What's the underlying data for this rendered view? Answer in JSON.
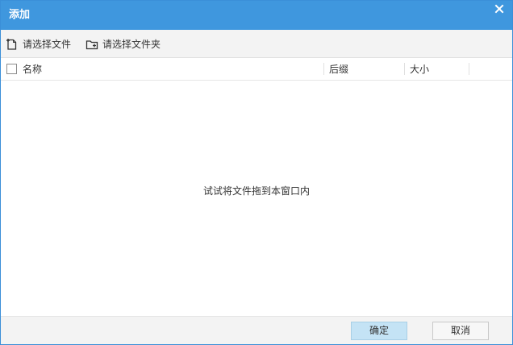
{
  "window": {
    "title": "添加",
    "close_icon": "close-icon"
  },
  "toolbar": {
    "select_file_label": "请选择文件",
    "select_file_icon": "add-file-icon",
    "select_folder_label": "请选择文件夹",
    "select_folder_icon": "add-folder-icon"
  },
  "table": {
    "columns": [
      "名称",
      "后缀",
      "大小"
    ]
  },
  "drop_area": {
    "hint": "试试将文件拖到本窗口内"
  },
  "footer": {
    "ok_label": "确定",
    "cancel_label": "取消"
  },
  "colors": {
    "titlebar": "#3f97de",
    "ok_button": "#c4e3f5",
    "toolbar_bg": "#f3f3f3"
  }
}
